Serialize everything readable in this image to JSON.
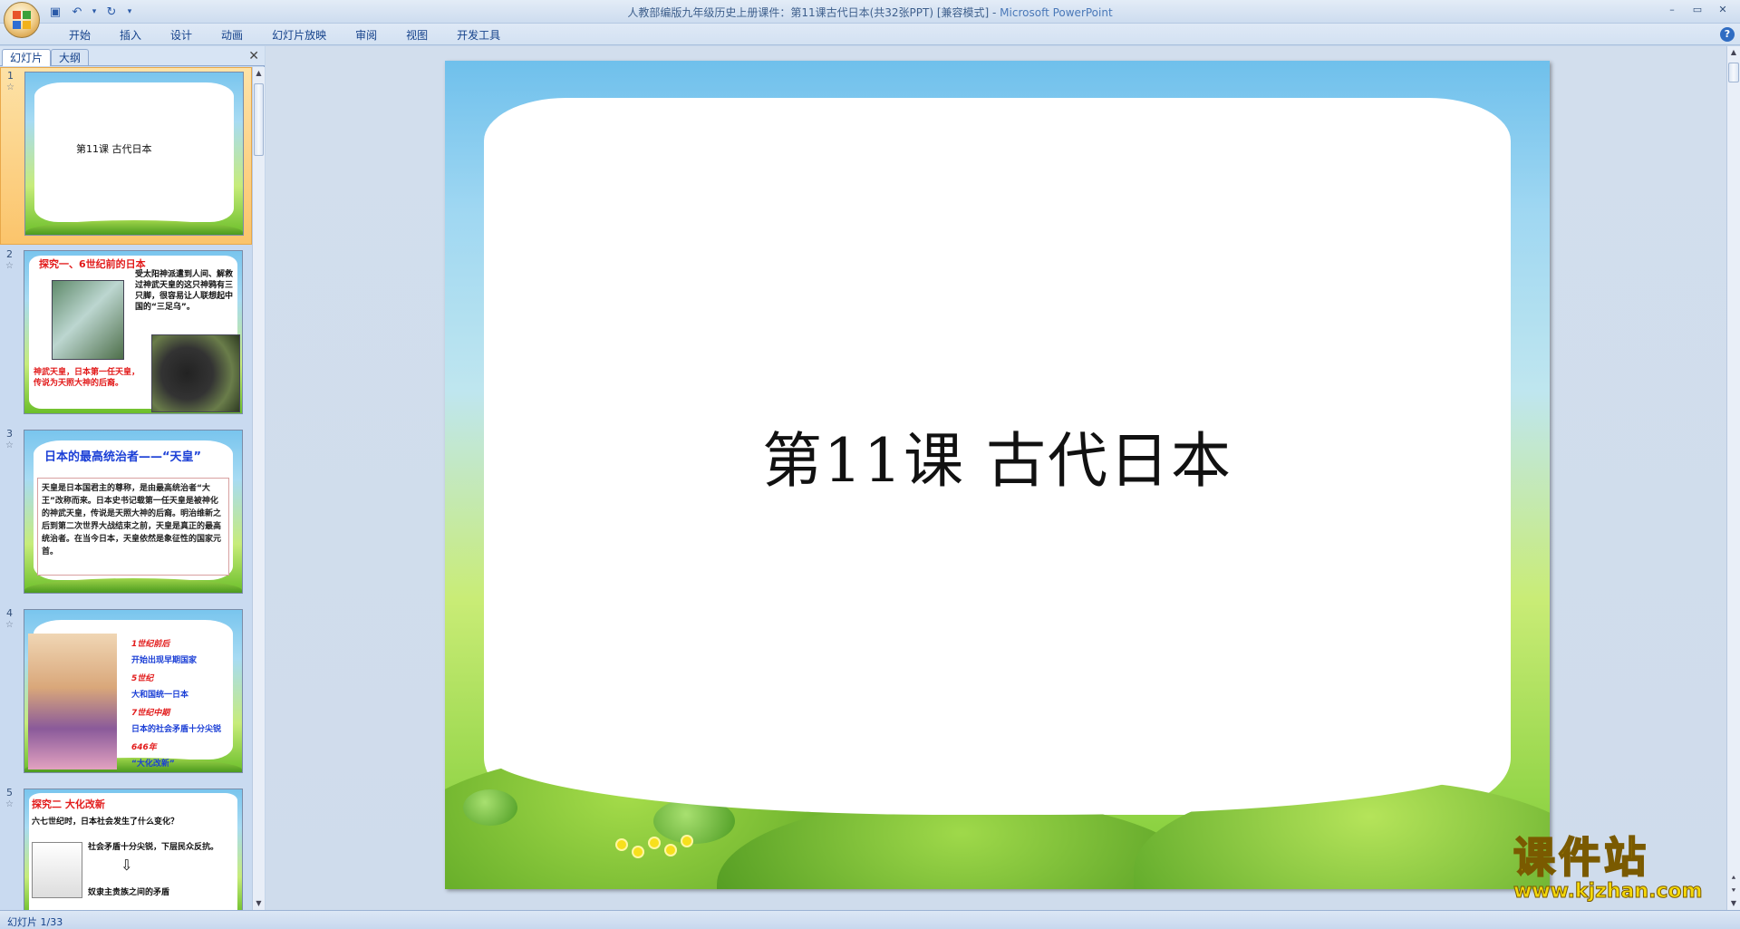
{
  "titlebar": {
    "document_title": "人教部编版九年级历史上册课件：第11课古代日本(共32张PPT) [兼容模式]",
    "separator": " - ",
    "app_name": "Microsoft PowerPoint",
    "minimize": "–",
    "maximize": "▭",
    "close": "✕"
  },
  "qat": {
    "save": "▣",
    "undo": "↶",
    "undo_dropdown": "▾",
    "redo": "↻",
    "customize": "▾"
  },
  "ribbon": {
    "tabs": [
      "开始",
      "插入",
      "设计",
      "动画",
      "幻灯片放映",
      "审阅",
      "视图",
      "开发工具"
    ],
    "help": "?"
  },
  "left_pane": {
    "tabs": [
      "幻灯片",
      "大纲"
    ],
    "close": "✕",
    "slides": [
      {
        "number": "1",
        "title": "第11课   古代日本"
      },
      {
        "number": "2",
        "heading": "探究一、6世纪前的日本",
        "body": "受太阳神派遣到人间、解救过神武天皇的这只神鸦有三只脚，很容易让人联想起中国的“三足乌”。",
        "caption": "神武天皇，日本第一任天皇，传说为天照大神的后裔。"
      },
      {
        "number": "3",
        "heading": "日本的最高统治者——“天皇”",
        "body": "天皇是日本国君主的尊称，是由最高统治者“大王”改称而来。日本史书记载第一任天皇是被神化的神武天皇，传说是天照大神的后裔。明治维新之后到第二次世界大战结束之前，天皇是真正的最高统治者。在当今日本，天皇依然是象征性的国家元首。"
      },
      {
        "number": "4",
        "lines": [
          {
            "text": "1世纪前后",
            "color": "red"
          },
          {
            "text": "开始出现早期国家",
            "color": "blue"
          },
          {
            "text": "5世纪",
            "color": "red"
          },
          {
            "text": "大和国统一日本",
            "color": "blue"
          },
          {
            "text": "7世纪中期",
            "color": "red"
          },
          {
            "text": "日本的社会矛盾十分尖锐",
            "color": "blue"
          },
          {
            "text": "646年",
            "color": "red"
          },
          {
            "text": "“大化改新”",
            "color": "blue"
          }
        ]
      },
      {
        "number": "5",
        "heading": "探究二   大化改新",
        "question": "六七世纪时，日本社会发生了什么变化？",
        "line1": "社会矛盾十分尖锐，下层民众反抗。",
        "line2": "奴隶主贵族之间的矛盾"
      }
    ]
  },
  "slide": {
    "title": "第11课  古代日本"
  },
  "watermark": {
    "brand": "课件站",
    "url": "www.kjzhan.com"
  },
  "statusbar": {
    "text": "幻灯片 1/33"
  },
  "colors": {
    "accent": "#15428b",
    "selected_thumb": "#fbc46b",
    "title_red": "#e21b1b",
    "title_blue": "#1b3fd6"
  }
}
